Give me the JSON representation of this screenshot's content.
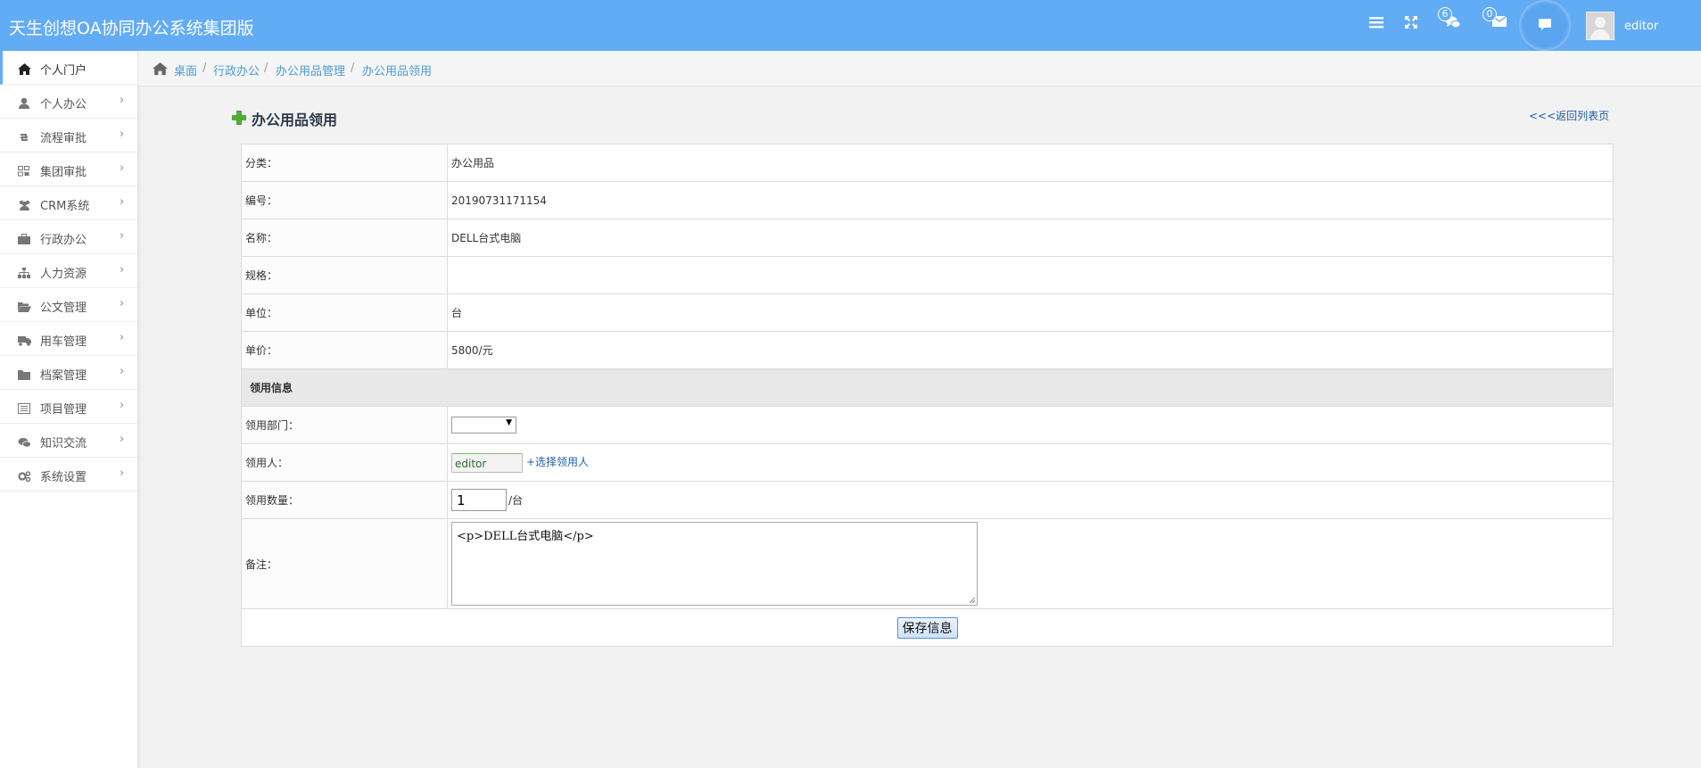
{
  "header": {
    "brand": "天生创想OA协同办公系统集团版",
    "icons": [
      "menu-icon",
      "fullscreen-icon",
      "chat-icon",
      "mail-icon",
      "message-bubble-icon"
    ],
    "chat_count": "6",
    "mail_count": "0",
    "username": "editor"
  },
  "sidebar": {
    "items": [
      {
        "label": "个人门户",
        "icon": "home-icon"
      },
      {
        "label": "个人办公",
        "icon": "user-icon"
      },
      {
        "label": "流程审批",
        "icon": "retweet-icon"
      },
      {
        "label": "集团审批",
        "icon": "grid-icon"
      },
      {
        "label": "CRM系统",
        "icon": "users-icon"
      },
      {
        "label": "行政办公",
        "icon": "briefcase-icon"
      },
      {
        "label": "人力资源",
        "icon": "sitemap-icon"
      },
      {
        "label": "公文管理",
        "icon": "folder-open-icon"
      },
      {
        "label": "用车管理",
        "icon": "truck-icon"
      },
      {
        "label": "档案管理",
        "icon": "folder-icon"
      },
      {
        "label": "项目管理",
        "icon": "list-icon"
      },
      {
        "label": "知识交流",
        "icon": "comments-icon"
      },
      {
        "label": "系统设置",
        "icon": "cogs-icon"
      }
    ]
  },
  "breadcrumb": [
    "桌面",
    "行政办公",
    "办公用品管理",
    "办公用品领用"
  ],
  "form": {
    "title": "办公用品领用",
    "back_link": "<<<返回列表页",
    "rows": [
      {
        "label": "分类：",
        "value": "办公用品"
      },
      {
        "label": "编号：",
        "value": "20190731171154"
      },
      {
        "label": "名称：",
        "value": "DELL台式电脑"
      },
      {
        "label": "规格：",
        "value": ""
      },
      {
        "label": "单位：",
        "value": "台"
      },
      {
        "label": "单价：",
        "value": "5800/元"
      }
    ],
    "section_title": "领用信息",
    "dept_label": "领用部门：",
    "dept_value": "",
    "person_label": "领用人：",
    "person_value": "editor",
    "person_pick": "+选择领用人",
    "qty_label": "领用数量：",
    "qty_value": "1",
    "qty_unit": "/台",
    "remark_label": "备注：",
    "remark_value": "<p>DELL台式电脑</p>",
    "save_label": "保存信息"
  },
  "colors": {
    "header": "#62acf6",
    "link": "#4b9bd8",
    "active": "#62acf6"
  }
}
